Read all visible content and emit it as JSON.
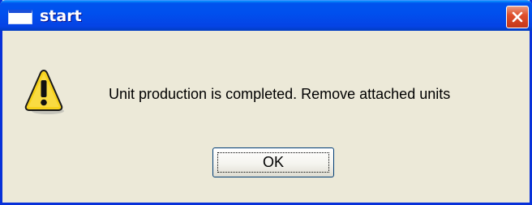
{
  "window": {
    "title": "start"
  },
  "dialog": {
    "icon": "warning-icon",
    "message": "Unit production is completed. Remove attached units",
    "ok_label": "OK"
  },
  "theme": {
    "titlebar_color": "#0053ee",
    "close_button_color": "#e0502c",
    "dialog_background": "#ece9d8"
  }
}
